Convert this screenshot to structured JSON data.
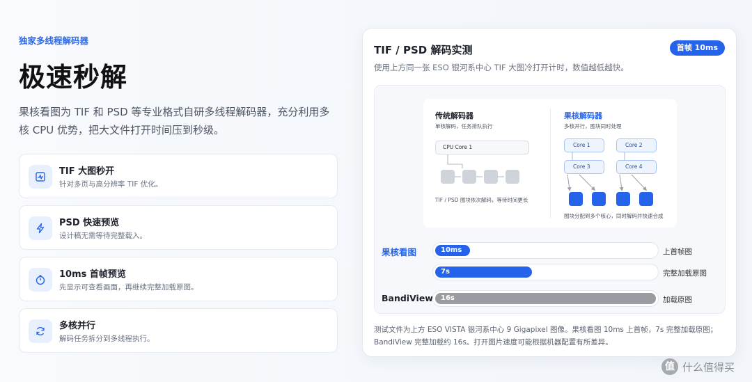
{
  "left": {
    "eyebrow": "独家多线程解码器",
    "hero_title": "极速秒解",
    "intro": "果核看图为 TIF 和 PSD 等专业格式自研多线程解码器，充分利用多核 CPU 优势，把大文件打开时间压到秒级。",
    "features": [
      {
        "title": "TIF 大图秒开",
        "desc": "针对多页与高分辨率 TIF 优化。",
        "icon": "chart-icon"
      },
      {
        "title": "PSD 快速预览",
        "desc": "设计稿无需等待完整载入。",
        "icon": "lightning-icon"
      },
      {
        "title": "10ms 首帧预览",
        "desc": "先显示可查看画面，再继续完整加载原图。",
        "icon": "stopwatch-icon"
      },
      {
        "title": "多核并行",
        "desc": "解码任务拆分到多线程执行。",
        "icon": "refresh-icon"
      }
    ]
  },
  "card": {
    "title": "TIF / PSD 解码实测",
    "badge": "首帧 10ms",
    "subtitle": "使用上方同一张 ESO 银河系中心 TIF 大图冷打开计时，数值越低越快。",
    "diagram": {
      "traditional": {
        "title": "传统解码器",
        "sub": "单核解码，任务排队执行",
        "cpu": "CPU Core 1",
        "note": "TIF / PSD 图块依次解码，等待时间更长"
      },
      "guohe": {
        "title": "果核解码器",
        "sub": "多核并行，图块同时处理",
        "cores": [
          "Core 1",
          "Core 2",
          "Core 3",
          "Core 4"
        ],
        "note": "图块分配到多个核心，同时解码并快速合成"
      }
    },
    "bars": [
      {
        "app": "果核看图",
        "value_label": "10ms",
        "value_ms": 10,
        "metric": "上首帧图",
        "color": "#2563eb"
      },
      {
        "app": "",
        "value_label": "7s",
        "value_ms": 7000,
        "metric": "完整加载原图",
        "color": "#2563eb"
      },
      {
        "app": "BandiView",
        "value_label": "16s",
        "value_ms": 16000,
        "metric": "加载原图",
        "color": "#9a9ca1"
      }
    ],
    "footnote": "测试文件为上方 ESO VISTA 银河系中心 9 Gigapixel 图像。果核看图 10ms 上首帧，7s 完整加载原图；BandiView 完整加载约 16s。打开图片速度可能根据机器配置有所差异。"
  },
  "watermark": {
    "glyph": "值",
    "text": "什么值得买"
  },
  "colors": {
    "accent": "#2563eb",
    "gray_bar": "#9a9ca1",
    "eyebrow": "#2f6ae6"
  }
}
